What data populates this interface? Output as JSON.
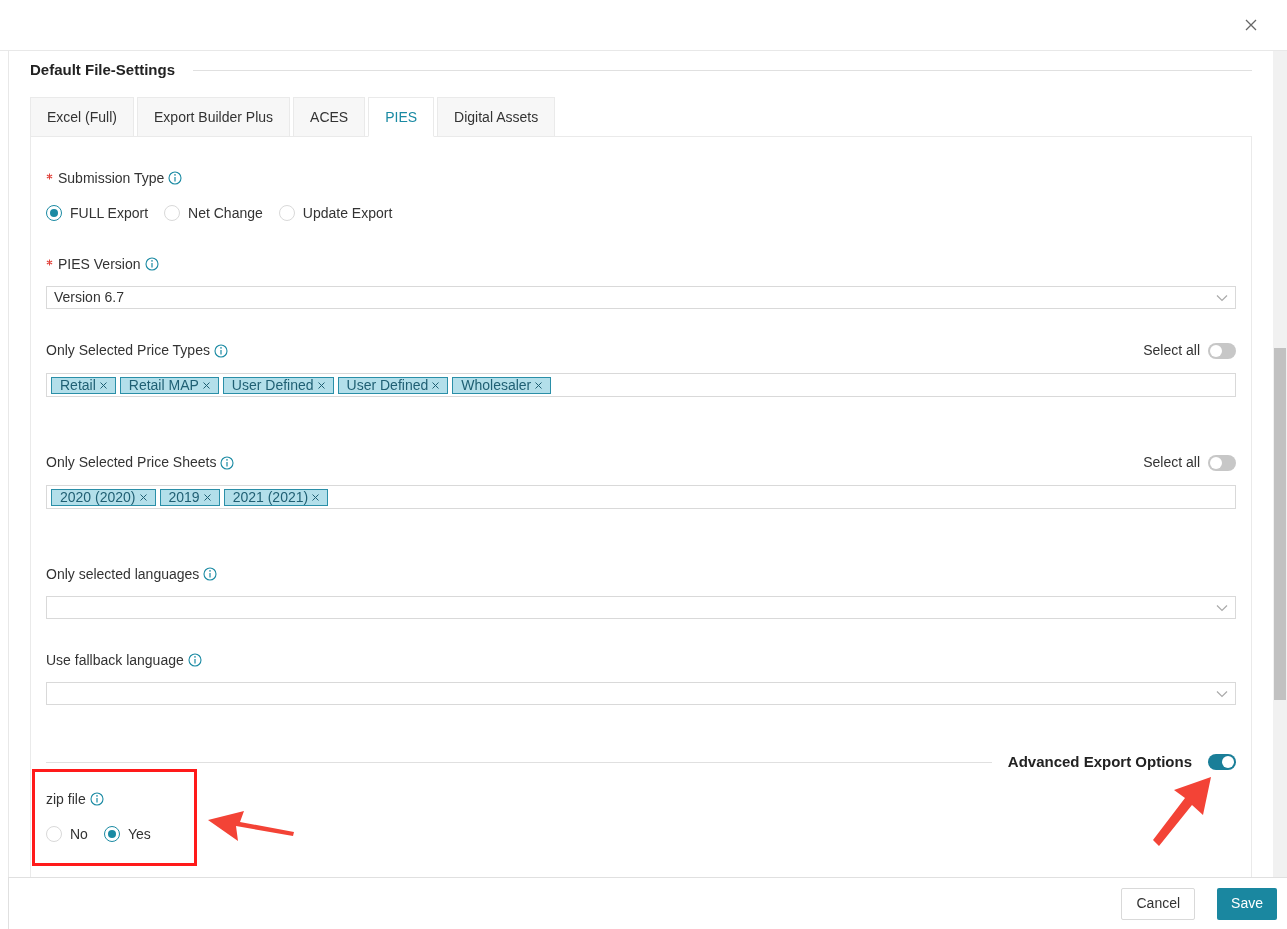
{
  "section_title": "Default File-Settings",
  "tabs": [
    {
      "label": "Excel (Full)",
      "selected": false
    },
    {
      "label": "Export Builder Plus",
      "selected": false
    },
    {
      "label": "ACES",
      "selected": false
    },
    {
      "label": "PIES",
      "selected": true
    },
    {
      "label": "Digital Assets",
      "selected": false
    }
  ],
  "fields": [
    {
      "kind": "radio",
      "label": "Submission Type",
      "required": true,
      "options": [
        {
          "label": "FULL Export",
          "selected": true
        },
        {
          "label": "Net Change",
          "selected": false
        },
        {
          "label": "Update Export",
          "selected": false
        }
      ]
    },
    {
      "kind": "select",
      "label": "PIES Version",
      "required": true,
      "value": "Version 6.7"
    },
    {
      "kind": "tags",
      "label": "Only Selected Price Types",
      "required": false,
      "select_all": {
        "label": "Select all",
        "on": false
      },
      "tags": [
        "Retail",
        "Retail MAP",
        "User Defined",
        "User Defined",
        "Wholesaler"
      ]
    },
    {
      "kind": "tags",
      "label": "Only Selected Price Sheets",
      "required": false,
      "select_all": {
        "label": "Select all",
        "on": false
      },
      "tags": [
        "2020 (2020)",
        "2019",
        "2021 (2021)"
      ]
    },
    {
      "kind": "select",
      "label": "Only selected languages",
      "required": false
    },
    {
      "kind": "select",
      "label": "Use fallback language",
      "required": false
    }
  ],
  "advanced": {
    "label": "Advanced Export Options",
    "on": true
  },
  "zip": {
    "label": "zip file",
    "options": [
      {
        "label": "No",
        "selected": false
      },
      {
        "label": "Yes",
        "selected": true
      }
    ]
  },
  "buttons": [
    {
      "label": "Cancel",
      "kind": "secondary"
    },
    {
      "label": "Save",
      "kind": "primary"
    }
  ]
}
